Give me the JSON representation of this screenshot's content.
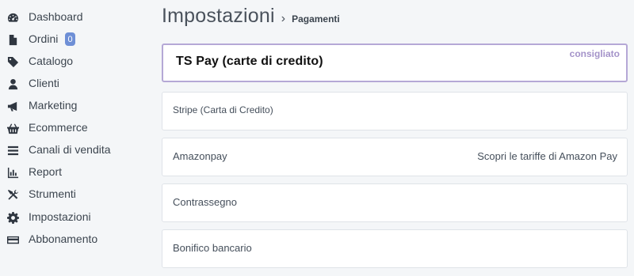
{
  "sidebar": {
    "items": [
      {
        "label": "Dashboard",
        "icon": "dashboard-icon"
      },
      {
        "label": "Ordini",
        "icon": "document-icon",
        "badge": "0"
      },
      {
        "label": "Catalogo",
        "icon": "tag-icon"
      },
      {
        "label": "Clienti",
        "icon": "user-icon"
      },
      {
        "label": "Marketing",
        "icon": "megaphone-icon"
      },
      {
        "label": "Ecommerce",
        "icon": "basket-icon"
      },
      {
        "label": "Canali di vendita",
        "icon": "bars-icon"
      },
      {
        "label": "Report",
        "icon": "chart-icon"
      },
      {
        "label": "Strumenti",
        "icon": "tools-icon"
      },
      {
        "label": "Impostazioni",
        "icon": "gear-icon"
      },
      {
        "label": "Abbonamento",
        "icon": "credit-card-icon"
      }
    ]
  },
  "header": {
    "title": "Impostazioni",
    "separator": "›",
    "crumb": "Pagamenti"
  },
  "payments": [
    {
      "label": "TS Pay (carte di credito)",
      "tag": "consigliato",
      "featured": true
    },
    {
      "label": "Stripe (Carta di Credito)"
    },
    {
      "label": "Amazonpay",
      "link": "Scopri le tariffe di Amazon Pay"
    },
    {
      "label": "Contrassegno"
    },
    {
      "label": "Bonifico bancario"
    }
  ],
  "colors": {
    "featured_border": "#b5a8d6",
    "tag": "#a493c9",
    "badge": "#6e8fd6"
  }
}
